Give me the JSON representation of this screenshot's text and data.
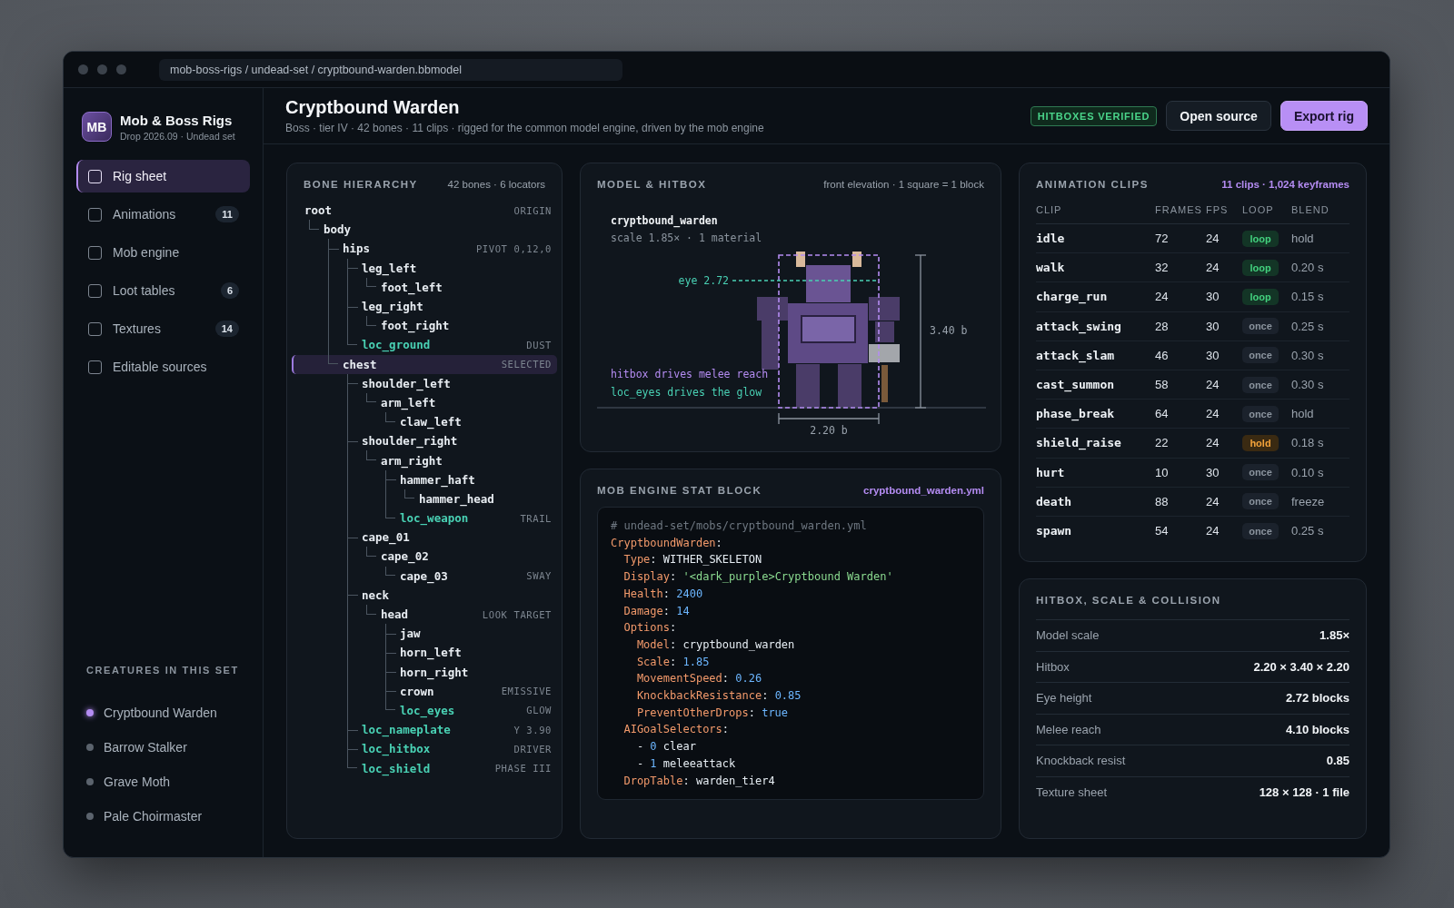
{
  "window": {
    "path": "mob-boss-rigs / undead-set / cryptbound-warden.bbmodel"
  },
  "brand": {
    "logo": "MB",
    "name": "Mob & Boss Rigs",
    "subtitle": "Drop 2026.09 · Undead set"
  },
  "sidebar": {
    "items": [
      {
        "label": "Rig sheet",
        "selected": true
      },
      {
        "label": "Animations",
        "count": "11",
        "selected": false
      },
      {
        "label": "Mob engine",
        "selected": false
      },
      {
        "label": "Loot tables",
        "count": "6",
        "selected": false
      },
      {
        "label": "Textures",
        "count": "14",
        "selected": false
      },
      {
        "label": "Editable sources",
        "selected": false
      }
    ],
    "section_title": "CREATURES IN THIS SET",
    "creatures": [
      {
        "name": "Cryptbound Warden",
        "selected": true
      },
      {
        "name": "Barrow Stalker",
        "selected": false
      },
      {
        "name": "Grave Moth",
        "selected": false
      },
      {
        "name": "Pale Choirmaster",
        "selected": false
      }
    ]
  },
  "header": {
    "title": "Cryptbound Warden",
    "subtitle": "Boss · tier IV · 42 bones · 11 clips · rigged for the common model engine, driven by the mob engine",
    "badge": "HITBOXES VERIFIED",
    "buttons": [
      {
        "label": "Open source",
        "kind": "secondary"
      },
      {
        "label": "Export rig",
        "kind": "primary"
      }
    ]
  },
  "bones": {
    "title": "BONE HIERARCHY",
    "summary": "42 bones · 6 locators",
    "tree": [
      {
        "name": "root",
        "kind": "bone",
        "tag": "ORIGIN",
        "selected": false,
        "children": [
          {
            "name": "body",
            "kind": "bone",
            "selected": false,
            "children": [
              {
                "name": "hips",
                "kind": "bone",
                "tag": "PIVOT 0,12,0",
                "selected": false,
                "children": [
                  {
                    "name": "leg_left",
                    "kind": "bone",
                    "selected": false,
                    "children": [
                      {
                        "name": "foot_left",
                        "kind": "bone",
                        "selected": false
                      }
                    ]
                  },
                  {
                    "name": "leg_right",
                    "kind": "bone",
                    "selected": false,
                    "children": [
                      {
                        "name": "foot_right",
                        "kind": "bone",
                        "selected": false
                      }
                    ]
                  },
                  {
                    "name": "loc_ground",
                    "kind": "locator",
                    "tag": "DUST",
                    "selected": false
                  }
                ]
              },
              {
                "name": "chest",
                "kind": "bone",
                "tag": "SELECTED",
                "selected": true,
                "children": [
                  {
                    "name": "shoulder_left",
                    "kind": "bone",
                    "selected": false,
                    "children": [
                      {
                        "name": "arm_left",
                        "kind": "bone",
                        "selected": false,
                        "children": [
                          {
                            "name": "claw_left",
                            "kind": "bone",
                            "selected": false
                          }
                        ]
                      }
                    ]
                  },
                  {
                    "name": "shoulder_right",
                    "kind": "bone",
                    "selected": false,
                    "children": [
                      {
                        "name": "arm_right",
                        "kind": "bone",
                        "selected": false,
                        "children": [
                          {
                            "name": "hammer_haft",
                            "kind": "bone",
                            "selected": false,
                            "children": [
                              {
                                "name": "hammer_head",
                                "kind": "bone",
                                "selected": false
                              }
                            ]
                          },
                          {
                            "name": "loc_weapon",
                            "kind": "locator",
                            "tag": "TRAIL",
                            "selected": false
                          }
                        ]
                      }
                    ]
                  },
                  {
                    "name": "cape_01",
                    "kind": "bone",
                    "selected": false,
                    "children": [
                      {
                        "name": "cape_02",
                        "kind": "bone",
                        "selected": false,
                        "children": [
                          {
                            "name": "cape_03",
                            "kind": "bone",
                            "tag": "SWAY",
                            "selected": false
                          }
                        ]
                      }
                    ]
                  },
                  {
                    "name": "neck",
                    "kind": "bone",
                    "selected": false,
                    "children": [
                      {
                        "name": "head",
                        "kind": "bone",
                        "tag": "LOOK TARGET",
                        "selected": false,
                        "children": [
                          {
                            "name": "jaw",
                            "kind": "bone",
                            "selected": false
                          },
                          {
                            "name": "horn_left",
                            "kind": "bone",
                            "selected": false
                          },
                          {
                            "name": "horn_right",
                            "kind": "bone",
                            "selected": false
                          },
                          {
                            "name": "crown",
                            "kind": "bone",
                            "tag": "EMISSIVE",
                            "selected": false
                          },
                          {
                            "name": "loc_eyes",
                            "kind": "locator",
                            "tag": "GLOW",
                            "selected": false
                          }
                        ]
                      }
                    ]
                  },
                  {
                    "name": "loc_nameplate",
                    "kind": "locator",
                    "tag": "Y 3.90",
                    "selected": false
                  },
                  {
                    "name": "loc_hitbox",
                    "kind": "locator",
                    "tag": "DRIVER",
                    "selected": false
                  },
                  {
                    "name": "loc_shield",
                    "kind": "locator",
                    "tag": "PHASE III",
                    "selected": false
                  }
                ]
              }
            ]
          }
        ]
      }
    ]
  },
  "model": {
    "title": "MODEL & HITBOX",
    "note": "front elevation · 1 square = 1 block",
    "model_name": "cryptbound_warden",
    "model_info": "scale 1.85× · 1 material",
    "eye_label": "eye 2.72",
    "height_label": "3.40 b",
    "width_label": "2.20 b",
    "caption_hitbox": "hitbox drives melee reach",
    "caption_eyes": "loc_eyes drives the glow"
  },
  "stat_block": {
    "title": "MOB ENGINE STAT BLOCK",
    "file": "cryptbound_warden.yml",
    "lines": [
      [
        {
          "kind": "comment",
          "text": "# undead-set/mobs/cryptbound_warden.yml"
        }
      ],
      [
        {
          "kind": "key",
          "text": "CryptboundWarden"
        },
        {
          "kind": "plain",
          "text": ":"
        }
      ],
      [
        {
          "kind": "key",
          "text": "  Type"
        },
        {
          "kind": "plain",
          "text": ": WITHER_SKELETON"
        }
      ],
      [
        {
          "kind": "key",
          "text": "  Display"
        },
        {
          "kind": "plain",
          "text": ": "
        },
        {
          "kind": "string",
          "text": "'<dark_purple>Cryptbound Warden'"
        }
      ],
      [
        {
          "kind": "key",
          "text": "  Health"
        },
        {
          "kind": "plain",
          "text": ": "
        },
        {
          "kind": "number",
          "text": "2400"
        }
      ],
      [
        {
          "kind": "key",
          "text": "  Damage"
        },
        {
          "kind": "plain",
          "text": ": "
        },
        {
          "kind": "number",
          "text": "14"
        }
      ],
      [
        {
          "kind": "key",
          "text": "  Options"
        },
        {
          "kind": "plain",
          "text": ":"
        }
      ],
      [
        {
          "kind": "key",
          "text": "    Model"
        },
        {
          "kind": "plain",
          "text": ": cryptbound_warden"
        }
      ],
      [
        {
          "kind": "key",
          "text": "    Scale"
        },
        {
          "kind": "plain",
          "text": ": "
        },
        {
          "kind": "number",
          "text": "1.85"
        }
      ],
      [
        {
          "kind": "key",
          "text": "    MovementSpeed"
        },
        {
          "kind": "plain",
          "text": ": "
        },
        {
          "kind": "number",
          "text": "0.26"
        }
      ],
      [
        {
          "kind": "key",
          "text": "    KnockbackResistance"
        },
        {
          "kind": "plain",
          "text": ": "
        },
        {
          "kind": "number",
          "text": "0.85"
        }
      ],
      [
        {
          "kind": "key",
          "text": "    PreventOtherDrops"
        },
        {
          "kind": "plain",
          "text": ": "
        },
        {
          "kind": "number",
          "text": "true"
        }
      ],
      [
        {
          "kind": "key",
          "text": "  AIGoalSelectors"
        },
        {
          "kind": "plain",
          "text": ":"
        }
      ],
      [
        {
          "kind": "plain",
          "text": "    - "
        },
        {
          "kind": "number",
          "text": "0"
        },
        {
          "kind": "plain",
          "text": " clear"
        }
      ],
      [
        {
          "kind": "plain",
          "text": "    - "
        },
        {
          "kind": "number",
          "text": "1"
        },
        {
          "kind": "plain",
          "text": " meleeattack"
        }
      ],
      [
        {
          "kind": "key",
          "text": "  DropTable"
        },
        {
          "kind": "plain",
          "text": ": warden_tier4"
        }
      ]
    ]
  },
  "clips": {
    "title": "ANIMATION CLIPS",
    "summary": "11 clips · 1,024 keyframes",
    "columns": [
      "CLIP",
      "FRAMES",
      "FPS",
      "LOOP",
      "BLEND"
    ],
    "rows": [
      {
        "clip": "idle",
        "frames": "72",
        "fps": "24",
        "mode": {
          "label": "loop",
          "kind": "loop"
        },
        "blend": "hold"
      },
      {
        "clip": "walk",
        "frames": "32",
        "fps": "24",
        "mode": {
          "label": "loop",
          "kind": "loop"
        },
        "blend": "0.20 s"
      },
      {
        "clip": "charge_run",
        "frames": "24",
        "fps": "30",
        "mode": {
          "label": "loop",
          "kind": "loop"
        },
        "blend": "0.15 s"
      },
      {
        "clip": "attack_swing",
        "frames": "28",
        "fps": "30",
        "mode": {
          "label": "once",
          "kind": "once"
        },
        "blend": "0.25 s"
      },
      {
        "clip": "attack_slam",
        "frames": "46",
        "fps": "30",
        "mode": {
          "label": "once",
          "kind": "once"
        },
        "blend": "0.30 s"
      },
      {
        "clip": "cast_summon",
        "frames": "58",
        "fps": "24",
        "mode": {
          "label": "once",
          "kind": "once"
        },
        "blend": "0.30 s"
      },
      {
        "clip": "phase_break",
        "frames": "64",
        "fps": "24",
        "mode": {
          "label": "once",
          "kind": "once"
        },
        "blend": "hold"
      },
      {
        "clip": "shield_raise",
        "frames": "22",
        "fps": "24",
        "mode": {
          "label": "hold",
          "kind": "hold"
        },
        "blend": "0.18 s"
      },
      {
        "clip": "hurt",
        "frames": "10",
        "fps": "30",
        "mode": {
          "label": "once",
          "kind": "once"
        },
        "blend": "0.10 s"
      },
      {
        "clip": "death",
        "frames": "88",
        "fps": "24",
        "mode": {
          "label": "once",
          "kind": "once"
        },
        "blend": "freeze"
      },
      {
        "clip": "spawn",
        "frames": "54",
        "fps": "24",
        "mode": {
          "label": "once",
          "kind": "once"
        },
        "blend": "0.25 s"
      }
    ]
  },
  "collision": {
    "title": "HITBOX, SCALE & COLLISION",
    "rows": [
      {
        "label": "Model scale",
        "value": "1.85×"
      },
      {
        "label": "Hitbox",
        "value": "2.20 × 3.40 × 2.20"
      },
      {
        "label": "Eye height",
        "value": "2.72 blocks"
      },
      {
        "label": "Melee reach",
        "value": "4.10 blocks"
      },
      {
        "label": "Knockback resist",
        "value": "0.85"
      },
      {
        "label": "Texture sheet",
        "value": "128 × 128 · 1 file"
      }
    ]
  }
}
